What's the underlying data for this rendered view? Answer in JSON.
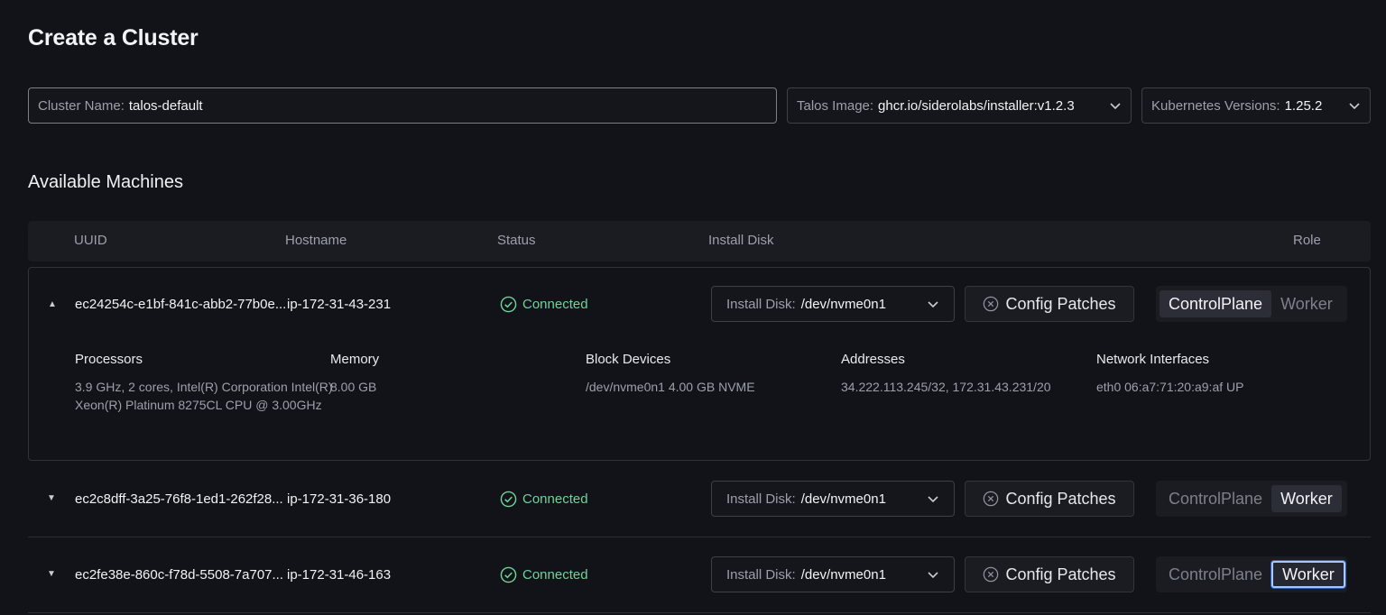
{
  "page": {
    "title": "Create a Cluster"
  },
  "form": {
    "cluster_name_label": "Cluster Name:",
    "cluster_name_value": "talos-default",
    "talos_image_label": "Talos Image:",
    "talos_image_value": "ghcr.io/siderolabs/installer:v1.2.3",
    "k8s_label": "Kubernetes Versions:",
    "k8s_value": "1.25.2"
  },
  "machines": {
    "title": "Available Machines",
    "columns": [
      "UUID",
      "Hostname",
      "Status",
      "Install Disk",
      "Role"
    ],
    "rows": [
      {
        "uuid": "ec24254c-e1bf-841c-abb2-77b0e...",
        "hostname": "ip-172-31-43-231",
        "status": "Connected",
        "disk_label": "Install Disk:",
        "disk_value": "/dev/nvme0n1",
        "patch_label": "Config Patches",
        "role_cp": "ControlPlane",
        "role_worker": "Worker",
        "selected_role": "ControlPlane",
        "expanded": true
      },
      {
        "uuid": "ec2c8dff-3a25-76f8-1ed1-262f28...",
        "hostname": "ip-172-31-36-180",
        "status": "Connected",
        "disk_label": "Install Disk:",
        "disk_value": "/dev/nvme0n1",
        "patch_label": "Config Patches",
        "role_cp": "ControlPlane",
        "role_worker": "Worker",
        "selected_role": "Worker",
        "expanded": false
      },
      {
        "uuid": "ec2fe38e-860c-f78d-5508-7a707...",
        "hostname": "ip-172-31-46-163",
        "status": "Connected",
        "disk_label": "Install Disk:",
        "disk_value": "/dev/nvme0n1",
        "patch_label": "Config Patches",
        "role_cp": "ControlPlane",
        "role_worker": "Worker",
        "selected_role": "Worker",
        "expanded": false
      }
    ],
    "details": {
      "processors_label": "Processors",
      "processors_value": "3.9 GHz, 2 cores, Intel(R) Corporation Intel(R) Xeon(R) Platinum 8275CL CPU @ 3.00GHz",
      "memory_label": "Memory",
      "memory_value": "8.00 GB",
      "block_label": "Block Devices",
      "block_value": "/dev/nvme0n1 4.00 GB NVME",
      "addresses_label": "Addresses",
      "addresses_value": "34.222.113.245/32, 172.31.43.231/20",
      "netif_label": "Network Interfaces",
      "netif_value": "eth0 06:a7:71:20:a9:af UP"
    }
  },
  "colors": {
    "background": "#111318",
    "status_connected": "#6fd39a",
    "focus_ring": "#a8c7ff"
  },
  "icons": {
    "caret_up": "caret-up-icon",
    "caret_down": "caret-down-icon",
    "status": "check-circle-icon",
    "patch": "x-circle-icon",
    "dropdown": "chevron-down-icon"
  }
}
